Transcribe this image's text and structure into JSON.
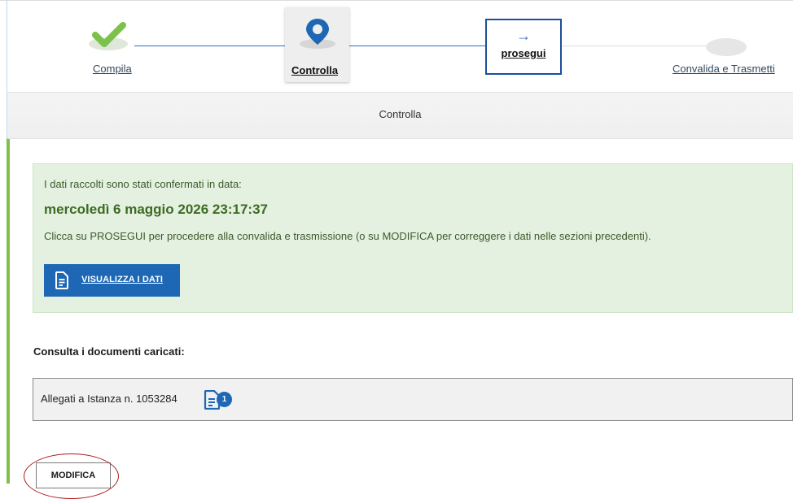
{
  "stepper": {
    "steps": [
      {
        "label": "Compila",
        "state": "done",
        "icon": "check-icon"
      },
      {
        "label": "Controlla",
        "state": "active",
        "icon": "map-pin-icon"
      },
      {
        "label": "prosegui",
        "state": "next",
        "icon": "arrow-right-icon",
        "arrow": "→"
      },
      {
        "label": "Convalida e Trasmetti",
        "state": "pending",
        "icon": "circle-icon"
      }
    ]
  },
  "section": {
    "title": "Controlla"
  },
  "info": {
    "confirmed_text": "I dati raccolti sono stati confermati in data:",
    "date": "mercoledì 6 maggio 2026 23:17:37",
    "instructions": "Clicca su PROSEGUI per procedere alla convalida e trasmissione (o su MODIFICA per correggere i dati nelle sezioni precedenti).",
    "view_button": "VISUALIZZA I DATI"
  },
  "documents": {
    "title": "Consulta i documenti caricati:",
    "attachment_label": "Allegati a Istanza n. 1053284",
    "attachment_count": "1"
  },
  "actions": {
    "modify_button": "MODIFICA"
  },
  "colors": {
    "accent_blue": "#1e67b5",
    "success_green": "#7cc24a",
    "info_bg": "#e4f1e0",
    "highlight_red": "#b01818"
  }
}
